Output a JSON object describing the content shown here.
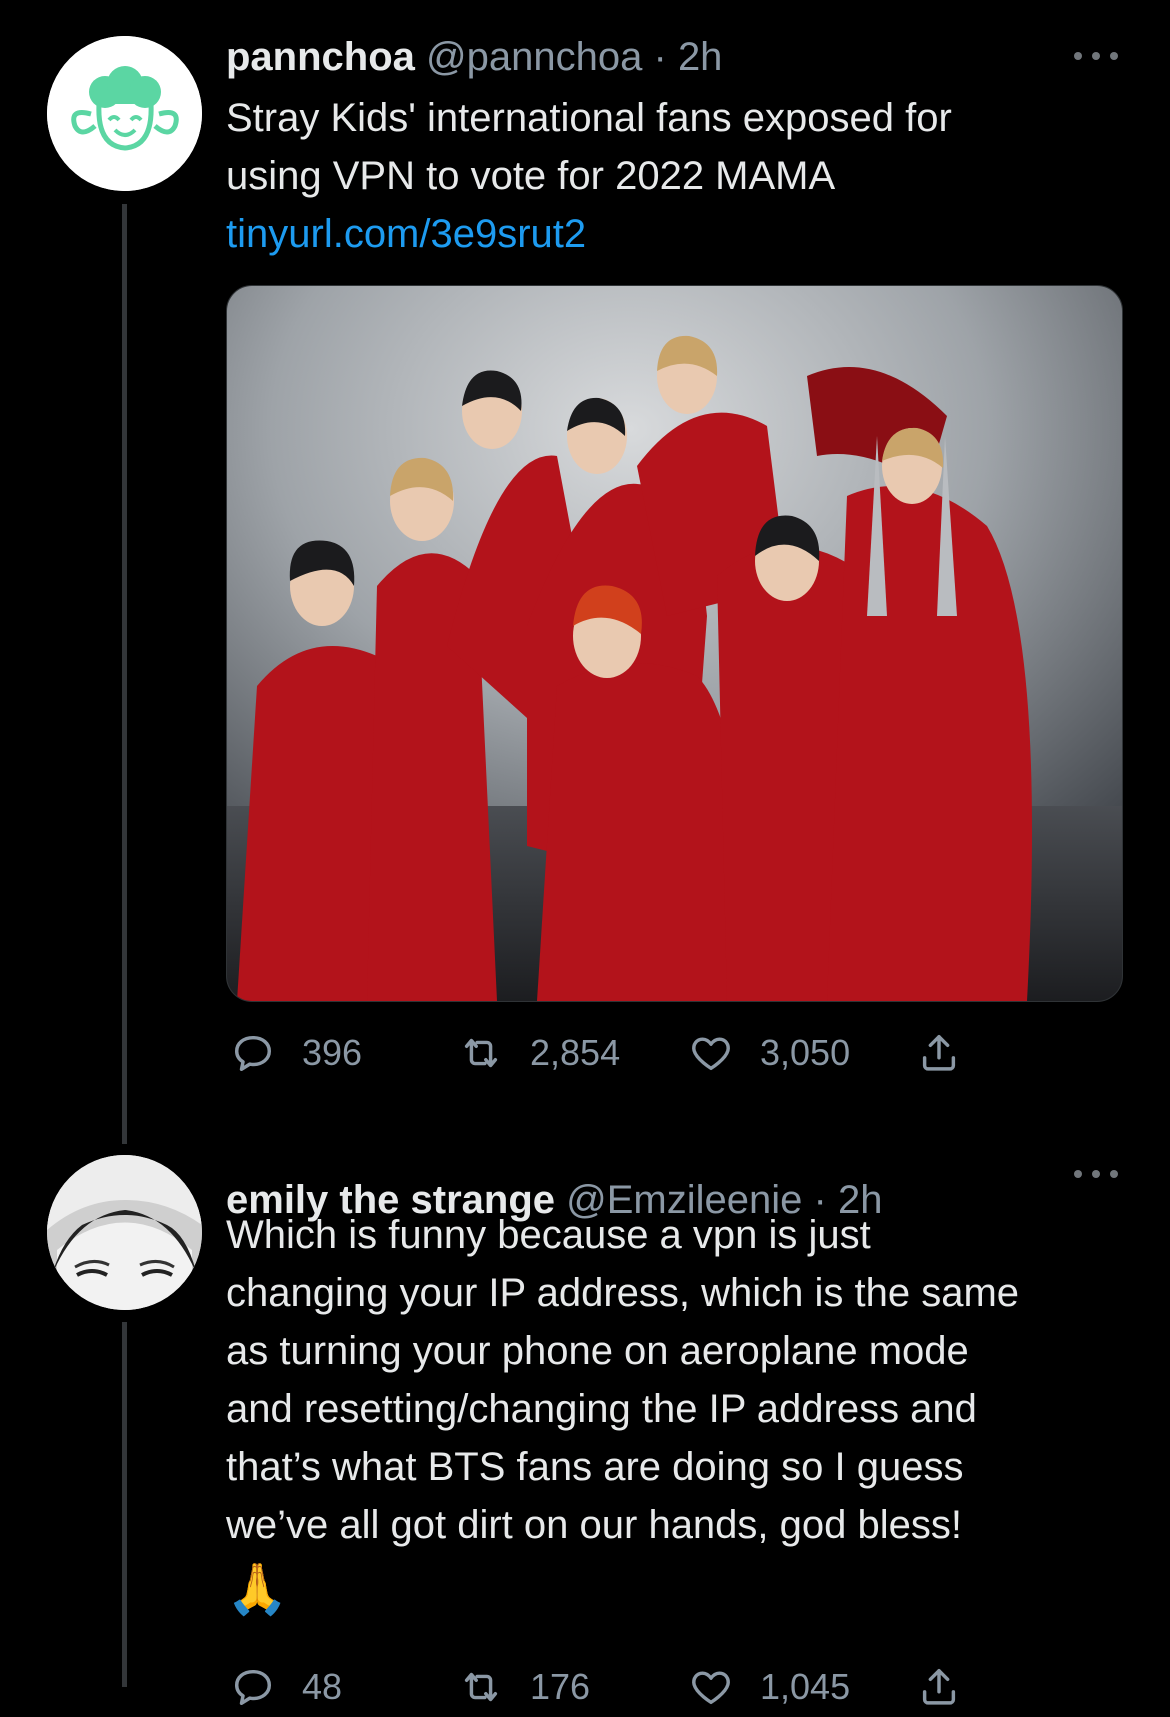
{
  "colors": {
    "background": "#000000",
    "text_primary": "#e7e9ea",
    "text_secondary": "#8b98a5",
    "link": "#1d9bf0",
    "thread_line": "#333639"
  },
  "tweets": [
    {
      "avatar_icon": "sheep-logo-icon",
      "display_name": "pannchoa",
      "handle": "@pannchoa",
      "separator": "·",
      "time": "2h",
      "text_lines": [
        "Stray Kids' international fans exposed for",
        "using VPN to vote for 2022 MAMA"
      ],
      "link": "tinyurl.com/3e9srut2",
      "media": "group-photo",
      "stats": {
        "replies": "396",
        "retweets": "2,854",
        "likes": "3,050"
      }
    },
    {
      "avatar_icon": "user-avatar-photo",
      "display_name": "emily the strange",
      "handle": "@Emzileenie",
      "separator": "·",
      "time": "2h",
      "text_lines": [
        "Which is funny because a vpn is just",
        "changing your IP address, which is the same",
        "as turning your phone on aeroplane mode",
        "and resetting/changing the IP address and",
        "that’s what BTS fans are doing so I guess",
        "we’ve all got dirt on our hands, god bless!"
      ],
      "emoji": "🙏",
      "stats": {
        "replies": "48",
        "retweets": "176",
        "likes": "1,045"
      }
    }
  ]
}
